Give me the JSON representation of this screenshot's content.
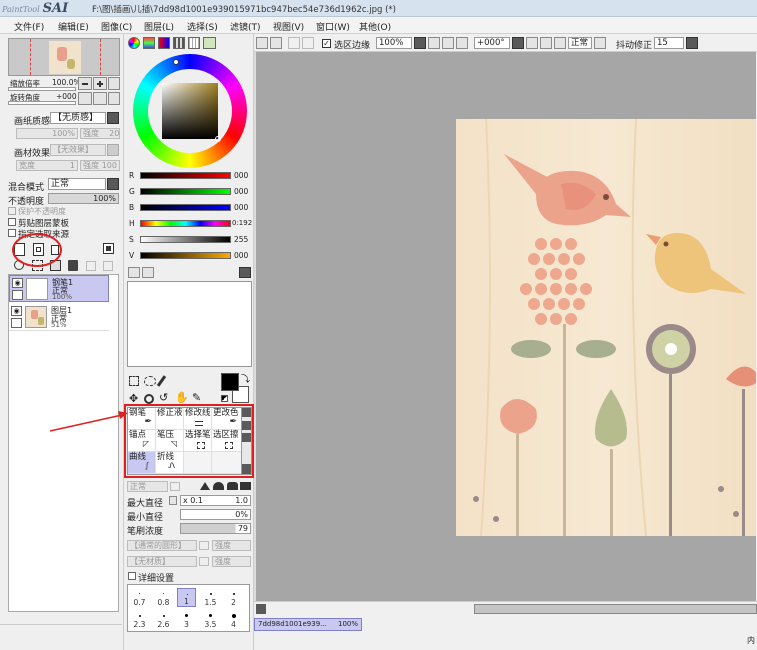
{
  "window": {
    "logo_small": "PaintTool",
    "logo_big": "SAI",
    "title": "F:\\图\\插画\\儿插\\7dd98d1001e939015971bc947bec54e736d1962c.jpg (*)"
  },
  "menu": [
    "文件(F)",
    "编辑(E)",
    "图像(C)",
    "图层(L)",
    "选择(S)",
    "滤镜(T)",
    "视图(V)",
    "窗口(W)",
    "其他(O)"
  ],
  "navigator": {
    "zoom_label": "缩放倍率",
    "zoom_value": "100.0%",
    "rotate_label": "旋转角度",
    "rotate_value": "+000"
  },
  "paper": {
    "texture_label": "画纸质感",
    "texture_value": "【无质感】",
    "scale_label": "倍率",
    "scale_value": "100%",
    "strength_label": "强度",
    "strength_value": "20",
    "effect_label": "画材效果",
    "effect_value": "【无效果】",
    "width_label": "宽度",
    "width_value": "1",
    "strength2_label": "强度",
    "strength2_value": "100"
  },
  "layer_props": {
    "blend_label": "混合模式",
    "blend_value": "正常",
    "opacity_label": "不透明度",
    "opacity_value": "100%",
    "protect_alpha": "保护不透明度",
    "clip_group": "剪贴图层蒙板",
    "selection_source": "指定选取来源"
  },
  "layers": [
    {
      "name": "钢笔1",
      "mode": "正常",
      "opacity": "100%"
    },
    {
      "name": "图层1",
      "mode": "正常",
      "opacity": "51%"
    }
  ],
  "colors": {
    "r_value": "000",
    "g_value": "000",
    "b_value": "000",
    "h_value": "0:192",
    "s_value": "255",
    "v_value": "000",
    "foreground": "#000000",
    "background": "#ffffff",
    "highlight": "#e02020"
  },
  "tools": [
    [
      "钢笔",
      "修正液",
      "修改线",
      "更改色"
    ],
    [
      "锚点",
      "笔压",
      "选择笔",
      "选区擦"
    ],
    [
      "曲线",
      "折线",
      "",
      ""
    ]
  ],
  "brush": {
    "mode_value": "正常",
    "max_size_label": "最大直径",
    "max_size_mult": "x 0.1",
    "max_size_value": "1.0",
    "min_size_label": "最小直径",
    "min_size_value": "0%",
    "density_label": "笔刷浓度",
    "density_value": "79",
    "shape_value": "【通常的圆形】",
    "shape_strength": "强度",
    "texture_value": "【无材质】",
    "texture_strength": "强度",
    "detail_label": "详细设置",
    "sizes_row1": [
      "0.7",
      "0.8",
      "1",
      "1.5",
      "2"
    ],
    "sizes_row2": [
      "2.3",
      "2.6",
      "3",
      "3.5",
      "4"
    ]
  },
  "canvas_toolbar": {
    "selection_edge": "选区边缘",
    "zoom": "100%",
    "angle": "+000°",
    "mode": "正常",
    "stabilizer_label": "抖动修正",
    "stabilizer_value": "15"
  },
  "status": {
    "doc_tab": "7dd98d1001e939...",
    "doc_zoom": "100%",
    "corner": "内"
  }
}
